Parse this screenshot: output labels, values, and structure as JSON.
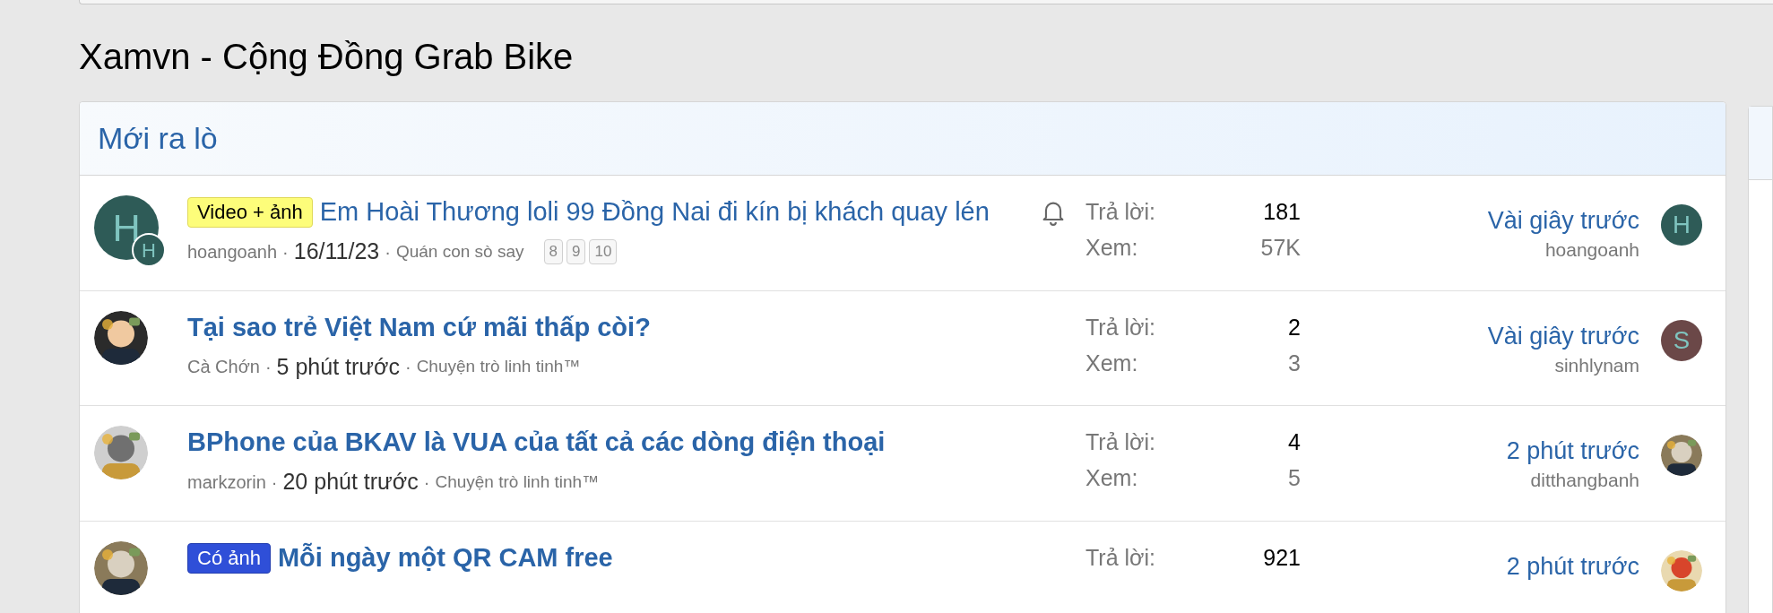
{
  "page_title": "Xamvn - Cộng Đồng Grab Bike",
  "panel": {
    "heading": "Mới ra lò",
    "threads": [
      {
        "avatar": {
          "kind": "letter",
          "letter": "H",
          "color": "#2e5b57",
          "badge_letter": "H"
        },
        "prefix": {
          "text": "Video + ảnh",
          "kind": "yellow"
        },
        "title": "Em Hoài Thương loli 99 Đồng Nai đi kín bị khách quay lén",
        "unread": false,
        "author": "hoangoanh",
        "date": "16/11/23",
        "forum": "Quán con sò say",
        "pages": [
          "8",
          "9",
          "10"
        ],
        "watched": true,
        "replies_label": "Trả lời:",
        "replies": "181",
        "views_label": "Xem:",
        "views": "57K",
        "last_time": "Vài giây trước",
        "last_user": "hoangoanh",
        "last_avatar": {
          "kind": "letter",
          "letter": "H",
          "color": "#2e5b57"
        }
      },
      {
        "title": "Tại sao trẻ Việt Nam cứ mãi thấp còi?",
        "unread": true,
        "author": "Cà Chớn",
        "date": "5 phút trước",
        "forum": "Chuyện trò linh tinh™",
        "watched": false,
        "replies_label": "Trả lời:",
        "replies": "2",
        "views_label": "Xem:",
        "views": "3",
        "last_time": "Vài giây trước",
        "last_user": "sinhlynam",
        "last_avatar": {
          "kind": "letter",
          "letter": "S",
          "color": "#6b4848"
        }
      },
      {
        "title": "BPhone của BKAV là VUA của tất cả các dòng điện thoại",
        "unread": true,
        "author": "markzorin",
        "date": "20 phút trước",
        "forum": "Chuyện trò linh tinh™",
        "watched": false,
        "replies_label": "Trả lời:",
        "replies": "4",
        "views_label": "Xem:",
        "views": "5",
        "last_time": "2 phút trước",
        "last_user": "ditthangbanh"
      },
      {
        "prefix": {
          "text": "Có ảnh",
          "kind": "blue"
        },
        "title": "Mỗi ngày một QR CAM free",
        "unread": true,
        "watched": false,
        "replies_label": "Trả lời:",
        "replies": "921",
        "last_time": "2 phút trước"
      }
    ]
  },
  "separator": "·"
}
